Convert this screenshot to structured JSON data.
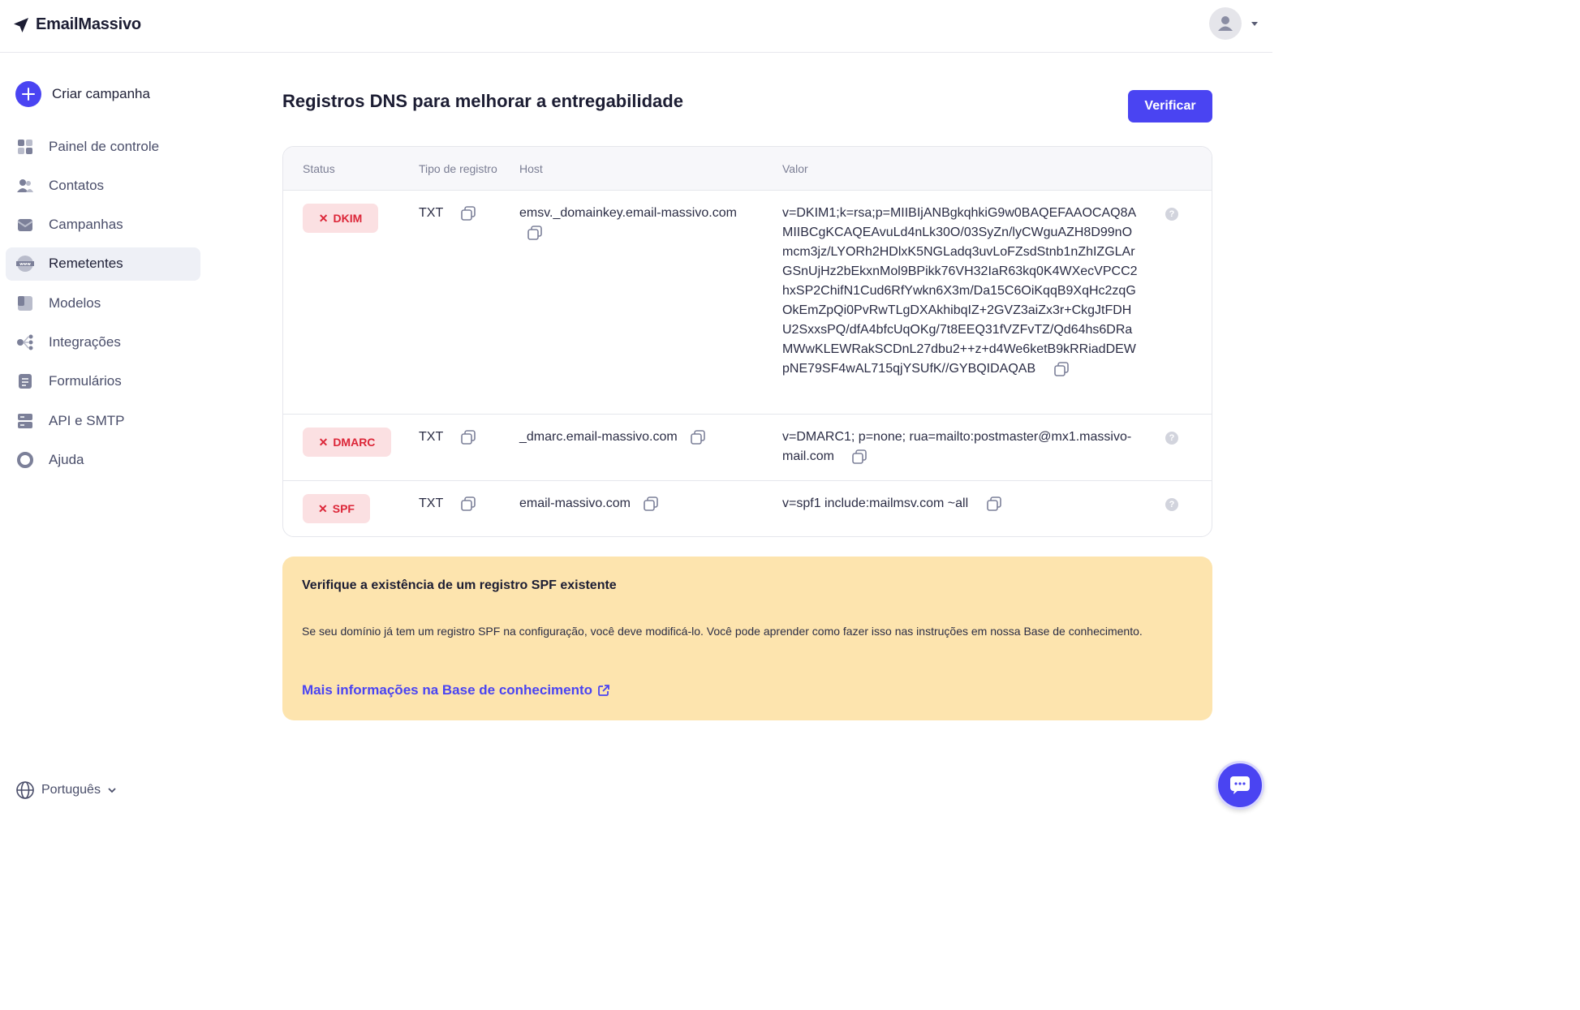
{
  "app": {
    "name": "EmailMassivo"
  },
  "sidebar": {
    "create_label": "Criar campanha",
    "items": [
      {
        "label": "Painel de controle",
        "icon": "dashboard-icon"
      },
      {
        "label": "Contatos",
        "icon": "contacts-icon"
      },
      {
        "label": "Campanhas",
        "icon": "campaigns-icon"
      },
      {
        "label": "Remetentes",
        "icon": "www-icon",
        "active": true
      },
      {
        "label": "Modelos",
        "icon": "templates-icon"
      },
      {
        "label": "Integrações",
        "icon": "integrations-icon"
      },
      {
        "label": "Formulários",
        "icon": "forms-icon"
      },
      {
        "label": "API e SMTP",
        "icon": "api-icon"
      },
      {
        "label": "Ajuda",
        "icon": "help-lifebuoy-icon"
      }
    ],
    "language": "Português"
  },
  "main": {
    "title": "Registros DNS para melhorar a entregabilidade",
    "verify_label": "Verificar",
    "table": {
      "headers": {
        "status": "Status",
        "type": "Tipo de registro",
        "host": "Host",
        "value": "Valor"
      },
      "rows": [
        {
          "status": "DKIM",
          "type": "TXT",
          "host": "emsv._domainkey.email-massivo.com",
          "value": "v=DKIM1;k=rsa;p=MIIBIjANBgkqhkiG9w0BAQEFAAOCAQ8AMIIBCgKCAQEAvuLd4nLk30O/03SyZn/lyCWguAZH8D99nOmcm3jz/LYORh2HDlxK5NGLadq3uvLoFZsdStnb1nZhIZGLArGSnUjHz2bEkxnMol9BPikk76VH32IaR63kq0K4WXecVPCC2hxSP2ChifN1Cud6RfYwkn6X3m/Da15C6OiKqqB9XqHc2zqGOkEmZpQi0PvRwTLgDXAkhibqIZ+2GVZ3aiZx3r+CkgJtFDHU2SxxsPQ/dfA4bfcUqOKg/7t8EEQ31fVZFvTZ/Qd64hs6DRaMWwKLEWRakSCDnL27dbu2++z+d4We6ketB9kRRiadDEWpNE79SF4wAL715qjYSUfK//GYBQIDAQAB"
        },
        {
          "status": "DMARC",
          "type": "TXT",
          "host": "_dmarc.email-massivo.com",
          "value": "v=DMARC1; p=none; rua=mailto:postmaster@mx1.massivo-mail.com"
        },
        {
          "status": "SPF",
          "type": "TXT",
          "host": "email-massivo.com",
          "value": "v=spf1 include:mailmsv.com ~all"
        }
      ]
    },
    "info": {
      "title": "Verifique a existência de um registro SPF existente",
      "text": "Se seu domínio já tem um registro SPF na configuração, você deve modificá-lo. Você pode aprender como fazer isso nas instruções em nossa Base de conhecimento.",
      "link": "Mais informações na Base de conhecimento"
    }
  },
  "colors": {
    "accent": "#4a44f2",
    "error": "#dc2638",
    "warning_bg": "#fde4ae"
  }
}
